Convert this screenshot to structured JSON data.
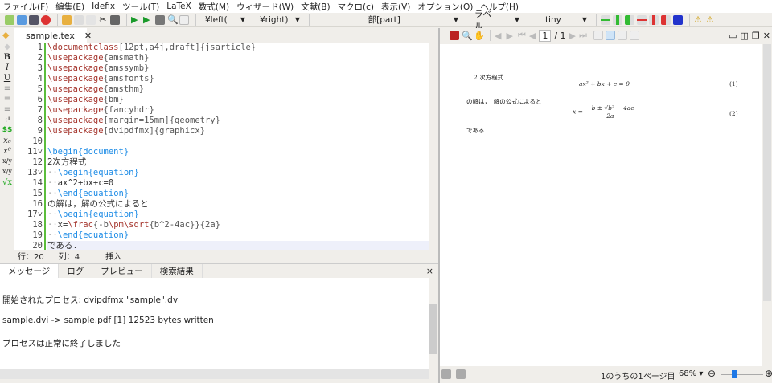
{
  "menu": [
    "ファイル(F)",
    "編集(E)",
    "Idefix",
    "ツール(T)",
    "LaTeX",
    "数式(M)",
    "ウィザード(W)",
    "文献(B)",
    "マクロ(c)",
    "表示(V)",
    "オプション(O)",
    "ヘルプ(H)"
  ],
  "toolbar": {
    "left_combo": "¥left(",
    "right_combo": "¥right)",
    "part_combo": "部[part]",
    "label_combo": "ラベル",
    "size_combo": "tiny"
  },
  "editor": {
    "tab": "sample.tex",
    "close": "✕",
    "lines": [
      [
        [
          "\\documentclass",
          "cmd"
        ],
        [
          "[12pt,a4j,draft]{jsarticle}",
          "arg"
        ]
      ],
      [
        [
          "\\usepackage",
          "cmd"
        ],
        [
          "{amsmath}",
          "arg"
        ]
      ],
      [
        [
          "\\usepackage",
          "cmd"
        ],
        [
          "{amssymb}",
          "arg"
        ]
      ],
      [
        [
          "\\usepackage",
          "cmd"
        ],
        [
          "{amsfonts}",
          "arg"
        ]
      ],
      [
        [
          "\\usepackage",
          "cmd"
        ],
        [
          "{amsthm}",
          "arg"
        ]
      ],
      [
        [
          "\\usepackage",
          "cmd"
        ],
        [
          "{bm}",
          "arg"
        ]
      ],
      [
        [
          "\\usepackage",
          "cmd"
        ],
        [
          "{fancyhdr}",
          "arg"
        ]
      ],
      [
        [
          "\\usepackage",
          "cmd"
        ],
        [
          "[margin=15mm]{geometry}",
          "arg"
        ]
      ],
      [
        [
          "\\usepackage",
          "cmd"
        ],
        [
          "[dvipdfmx]{graphicx}",
          "arg"
        ]
      ],
      [],
      [
        [
          "\\begin{document}",
          "env"
        ]
      ],
      [
        [
          "2次方程式",
          "txt"
        ]
      ],
      [
        [
          "··",
          "dot"
        ],
        [
          "\\begin{equation}",
          "env"
        ]
      ],
      [
        [
          "··",
          "dot"
        ],
        [
          "ax^2+bx+c=0",
          "txt"
        ]
      ],
      [
        [
          "··",
          "dot"
        ],
        [
          "\\end{equation}",
          "env"
        ]
      ],
      [
        [
          "の解は，解の公式によると",
          "txt"
        ]
      ],
      [
        [
          "··",
          "dot"
        ],
        [
          "\\begin{equation}",
          "env"
        ]
      ],
      [
        [
          "··",
          "dot"
        ],
        [
          "x=",
          "txt"
        ],
        [
          "\\frac",
          "cmd"
        ],
        [
          "{-b",
          "arg"
        ],
        [
          "\\pm",
          "cmd"
        ],
        [
          "\\sqrt",
          "cmd"
        ],
        [
          "{b^2-4ac}}{2a}",
          "arg"
        ]
      ],
      [
        [
          "··",
          "dot"
        ],
        [
          "\\end{equation}",
          "env"
        ]
      ],
      [
        [
          "である.",
          "txt"
        ]
      ]
    ],
    "fold_lines": [
      11,
      13,
      17
    ],
    "status": {
      "line": "行：20",
      "col": "列：4",
      "mode": "挿入"
    }
  },
  "bottom_panel": {
    "tabs": [
      "メッセージ",
      "ログ",
      "プレビュー",
      "検索結果"
    ],
    "close": "×",
    "messages": [
      "開始されたプロセス: dvipdfmx \"sample\".dvi",
      "sample.dvi -> sample.pdf [1] 12523 bytes written",
      "プロセスは正常に終了しました"
    ]
  },
  "pdf": {
    "page_input": "1",
    "page_total": "/ 1",
    "content": {
      "heading": "2 次方程式",
      "eq1": "ax² + bx + c = 0",
      "eq1_num": "(1)",
      "text1": "の解は，　解の公式によると",
      "eq2_lhs": "x =",
      "eq2_num": "−b ± √b² − 4ac",
      "eq2_den": "2a",
      "eq2_num_label": "(2)",
      "text2": "である."
    },
    "status": {
      "page_info": "1のうちの1ページ目",
      "zoom": "68%",
      "zoom_level": 0.3
    }
  }
}
